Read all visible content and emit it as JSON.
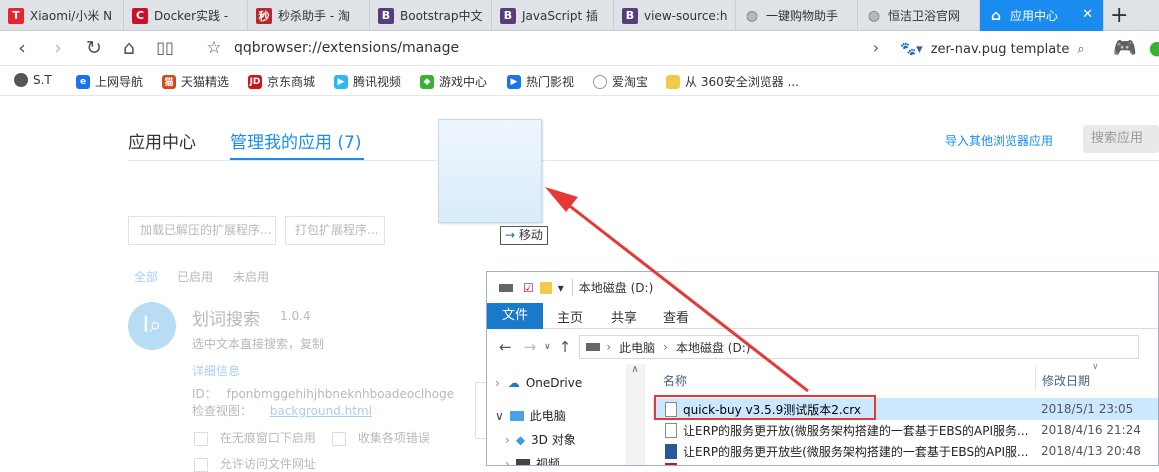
{
  "tabs": [
    {
      "label": "Xiaomi/小米 N",
      "favicon": "T",
      "color": "#e3262f"
    },
    {
      "label": "Docker实践 -",
      "favicon": "C",
      "color": "#c8102e"
    },
    {
      "label": "秒杀助手 - 淘",
      "favicon": "秒",
      "color": "#b8272c"
    },
    {
      "label": "Bootstrap中文",
      "favicon": "B",
      "color": "#563d7c"
    },
    {
      "label": "JavaScript 插",
      "favicon": "B",
      "color": "#563d7c"
    },
    {
      "label": "view-source:h",
      "favicon": "B",
      "color": "#563d7c"
    },
    {
      "label": "一键购物助手",
      "favicon": "globe-icon",
      "color": "#777"
    },
    {
      "label": "恒洁卫浴官网",
      "favicon": "globe-icon",
      "color": "#777"
    },
    {
      "label": "应用中心",
      "favicon": "home-icon",
      "color": "#fff",
      "active": true
    }
  ],
  "toolbar": {
    "address": "qqbrowser://extensions/manage",
    "search_text": "zer-nav.pug template"
  },
  "bookmarks": [
    {
      "label": "S.T",
      "color": "#555"
    },
    {
      "label": "上网导航",
      "color": "#1a73e8"
    },
    {
      "label": "天猫精选",
      "color": "#d14b1a"
    },
    {
      "label": "京东商城",
      "color": "#c81623"
    },
    {
      "label": "腾讯视频",
      "color": "#2fb8ec"
    },
    {
      "label": "游戏中心",
      "color": "#3cb034"
    },
    {
      "label": "热门影视",
      "color": "#1a73e8"
    },
    {
      "label": "爱淘宝",
      "color": "#777"
    },
    {
      "label": "从 360安全浏览器 ...",
      "color": "#e8b530"
    }
  ],
  "page": {
    "nav_app_center": "应用中心",
    "nav_manage": "管理我的应用 (7)",
    "import_link": "导入其他浏览器应用",
    "search_apps": "搜索应用",
    "load_unpacked": "加载已解压的扩展程序...",
    "pack_ext": "打包扩展程序...",
    "filters": [
      "全部",
      "已启用",
      "未启用"
    ],
    "ext": {
      "name": "划词搜索",
      "version": "1.0.4",
      "desc": "选中文本直接搜索，复制",
      "details": "详细信息",
      "id_label": "ID：",
      "id": "fponbmggehihjhbneknhboadeoclhoge",
      "inspect_label": "检查视图：",
      "inspect_link": "background.html",
      "opt_incognito": "在无痕窗口下启用",
      "opt_collect": "收集各项错误",
      "opt_file": "允许访问文件网址"
    },
    "drag_tooltip": "移动"
  },
  "explorer": {
    "title": "本地磁盘 (D:)",
    "ribbon_tabs": [
      "文件",
      "主页",
      "共享",
      "查看"
    ],
    "crumb": [
      "此电脑",
      "本地磁盘 (D:)"
    ],
    "col_name": "名称",
    "col_date": "修改日期",
    "nav": [
      "OneDrive",
      "此电脑",
      "3D 对象",
      "视频"
    ],
    "files": [
      {
        "name": "quick-buy v3.5.9测试版本2.crx",
        "date": "2018/5/1 23:05"
      },
      {
        "name": "让ERP的服务更开放(微服务架构搭建的一套基于EBS的API服务...",
        "date": "2018/4/16 21:24"
      },
      {
        "name": "让ERP的服务更开放些(微服务架构搭建的一套基于EBS的API服...",
        "date": "2018/4/13 20:48"
      }
    ]
  }
}
